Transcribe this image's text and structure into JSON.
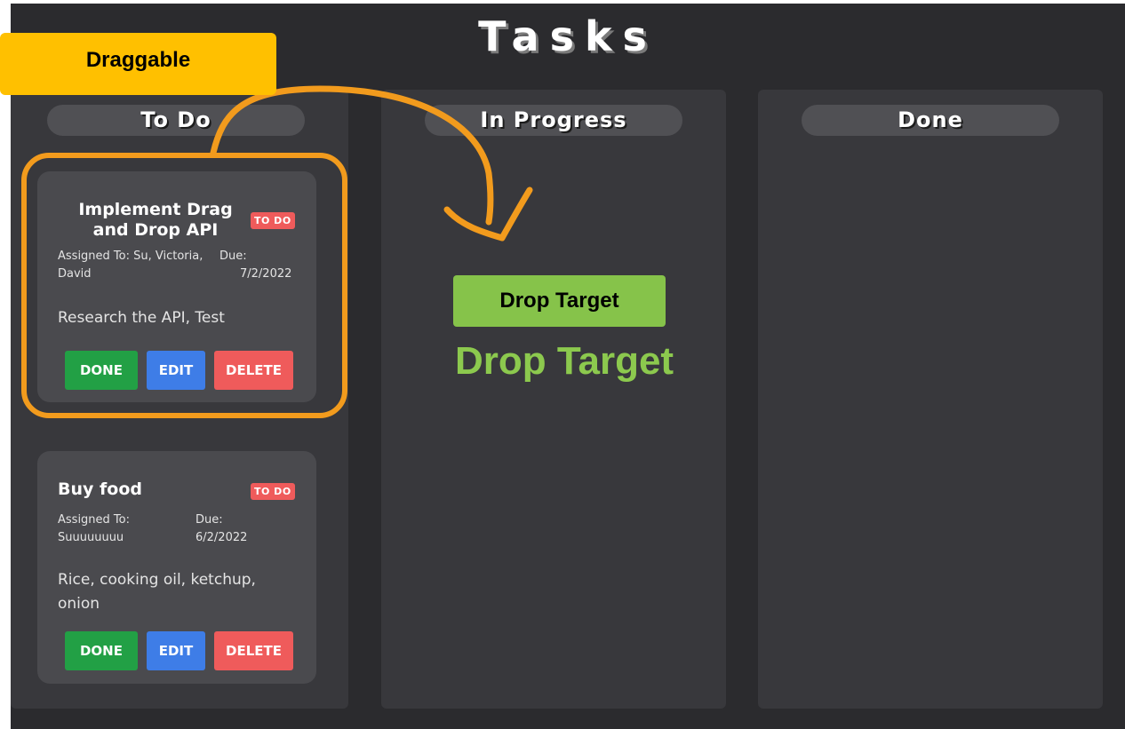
{
  "board": {
    "title": "Tasks"
  },
  "columns": [
    {
      "title": "To Do"
    },
    {
      "title": "In Progress"
    },
    {
      "title": "Done"
    }
  ],
  "cards": [
    {
      "title_line1": "Implement Drag",
      "title_line2": "and Drop API",
      "status": "TO DO",
      "assigned_line1": "Assigned To: Su, Victoria,",
      "assigned_line2": "David",
      "due_label": "Due:",
      "due_date": "7/2/2022",
      "description_line1": "Research the API, Test",
      "done_label": "DONE",
      "edit_label": "EDIT",
      "delete_label": "DELETE"
    },
    {
      "title": "Buy food",
      "status": "TO DO",
      "assigned_label": "Assigned To:",
      "assigned_names": "Suuuuuuuu",
      "due_label": "Due:",
      "due_date": "6/2/2022",
      "description_line1": "Rice, cooking oil, ketchup,",
      "description_line2": "onion",
      "done_label": "DONE",
      "edit_label": "EDIT",
      "delete_label": "DELETE"
    }
  ],
  "annotations": {
    "draggable_label": "Draggable",
    "drop_target_box_label": "Drop Target",
    "drop_target_text": "Drop Target",
    "highlight_color": "#f29b1d",
    "draggable_color": "#ffc000",
    "drop_target_color": "#86c34a"
  },
  "colors": {
    "page_bg": "#2b2b2e",
    "column_bg": "#38383c",
    "card_bg": "#4a4a4e",
    "done_button": "#22a045",
    "edit_button": "#3e7de7",
    "delete_button": "#ef5b5b",
    "status_badge": "#ef5b5b"
  }
}
